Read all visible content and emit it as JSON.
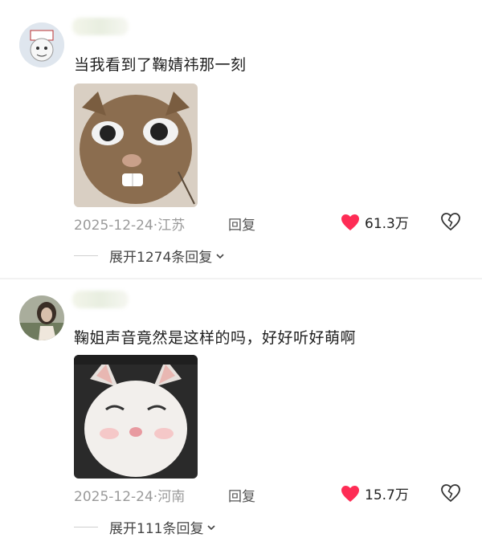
{
  "comments": [
    {
      "text": "当我看到了鞠婧祎那一刻",
      "date": "2025-12-24",
      "location": "·江苏",
      "reply_label": "回复",
      "likes": "61.3万",
      "expand_label": "展开1274条回复",
      "image": "surprised-cat-meme",
      "avatar": "cartoon-avatar"
    },
    {
      "text": "鞠姐声音竟然是这样的吗，好好听好萌啊",
      "date": "2025-12-24",
      "location": "·河南",
      "reply_label": "回复",
      "likes": "15.7万",
      "expand_label": "展开111条回复",
      "image": "sleepy-cat-meme",
      "avatar": "photo-avatar"
    }
  ],
  "colors": {
    "like": "#fe2c55",
    "muted": "#9a9a9a"
  },
  "icons": {
    "like": "heart-icon",
    "dislike": "broken-heart-icon",
    "expand": "chevron-down-icon"
  }
}
